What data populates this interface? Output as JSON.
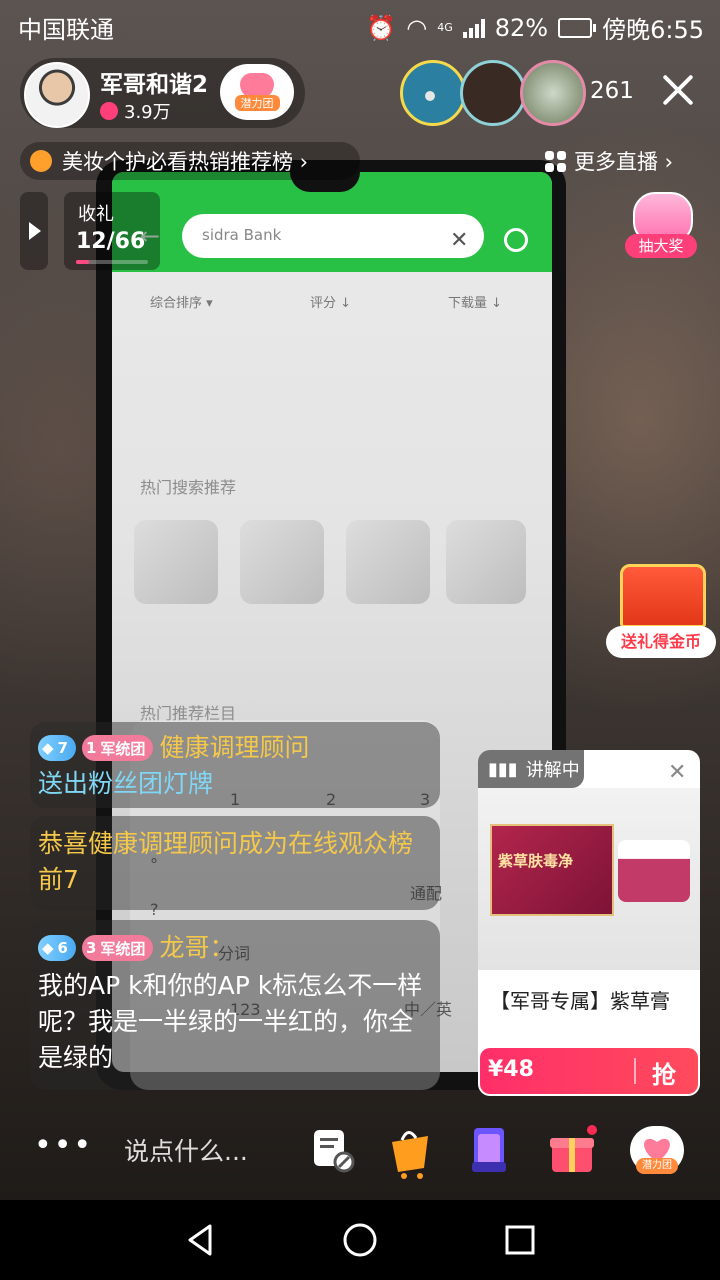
{
  "status_bar": {
    "carrier": "中国联通",
    "network": "4G",
    "battery": "82%",
    "time": "傍晚6:55"
  },
  "host": {
    "name": "军哥和谐2",
    "likes": "3.9万",
    "badge": "潜力团"
  },
  "viewers": {
    "count": "261"
  },
  "rank_bar": {
    "label": "美妆个护必看热销推荐榜 ›"
  },
  "more_live": {
    "label": "更多直播 ›"
  },
  "gift_counter": {
    "label": "收礼",
    "count": "12/66",
    "progress": 0.18
  },
  "lottery": {
    "label": "抽大奖"
  },
  "treasure": {
    "label": "送礼得金币"
  },
  "phone_screen": {
    "search_text": "sidra Bank",
    "sort_tabs": [
      "综合排序 ▾",
      "评分 ↓",
      "下载量 ↓"
    ],
    "section_1": "热门搜索推荐",
    "section_2": "热门推荐栏目"
  },
  "comments": [
    {
      "level": "7",
      "club_level": "1",
      "club": "军统团",
      "user": "健康调理顾问",
      "text": "送出粉丝团灯牌"
    },
    {
      "text": "恭喜健康调理顾问成为在线观众榜前7"
    },
    {
      "level": "6",
      "club_level": "3",
      "club": "军统团",
      "user": "龙哥：",
      "text": "我的AP k和你的AP k标怎么不一样呢？我是一半绿的一半红的，你全是绿的"
    }
  ],
  "product": {
    "tag": "讲解中",
    "box_label": "紫草肤毒净",
    "title": "【军哥专属】紫草膏",
    "price": "¥48",
    "buy": "抢"
  },
  "bottom": {
    "more": "•••",
    "input_placeholder": "说点什么...",
    "icons": [
      "comment-settings-icon",
      "shopping-bag-icon",
      "gift-card-icon",
      "gift-box-icon",
      "fan-club-icon"
    ],
    "fan_badge": "潜力团"
  },
  "colors": {
    "accent_pink": "#ff3f7a",
    "host_name_yellow": "#f5c84a",
    "phone_green": "#29c046",
    "comment_cyan": "#7fd6f5"
  }
}
